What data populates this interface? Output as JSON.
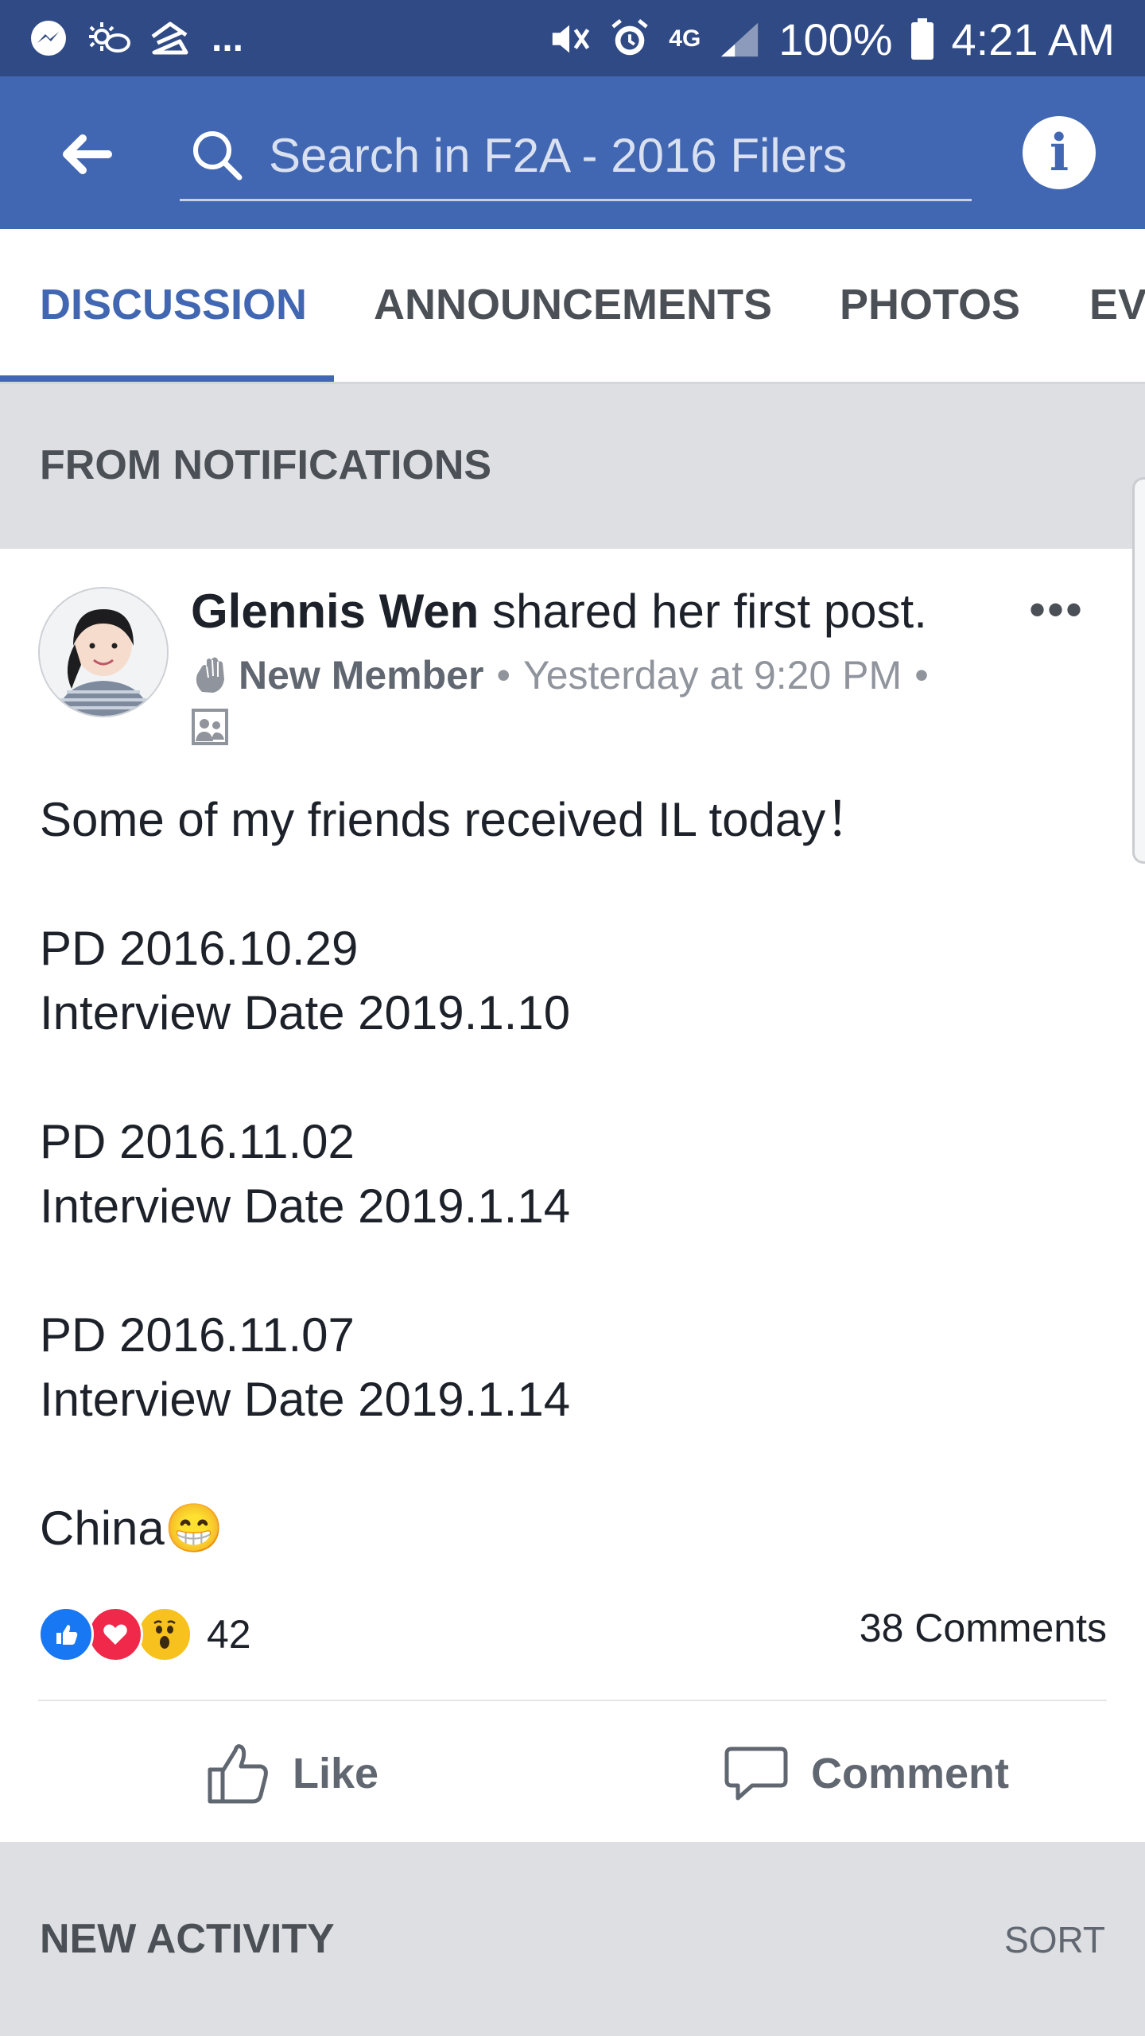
{
  "status_bar": {
    "battery": "100%",
    "time": "4:21 AM",
    "network": "4G",
    "more": "..."
  },
  "app_bar": {
    "search_placeholder": "Search in F2A - 2016 Filers",
    "info_label": "i"
  },
  "tabs": [
    {
      "label": "DISCUSSION",
      "active": true
    },
    {
      "label": "ANNOUNCEMENTS",
      "active": false
    },
    {
      "label": "PHOTOS",
      "active": false
    },
    {
      "label": "EV",
      "active": false
    }
  ],
  "sections": {
    "notifications_title": "FROM NOTIFICATIONS",
    "activity_title": "NEW ACTIVITY",
    "sort_label": "SORT"
  },
  "post": {
    "author": "Glennis Wen",
    "action": "shared her first post.",
    "more": "•••",
    "badge": "New Member",
    "separator": "•",
    "timestamp": "Yesterday at 9:20 PM",
    "lines": [
      "Some of my friends received IL today！",
      "",
      "PD 2016.10.29",
      "Interview Date 2019.1.10",
      "",
      "PD 2016.11.02",
      "Interview Date 2019.1.14",
      "",
      "PD 2016.11.07",
      "Interview Date 2019.1.14",
      "",
      "China😁"
    ],
    "reaction_count": "42",
    "comments_count": "38 Comments",
    "like_label": "Like",
    "comment_label": "Comment"
  },
  "colors": {
    "facebook_blue": "#4267b2",
    "status_bar": "#2f4a85",
    "like_blue": "#1877f2",
    "love_red": "#f0284a",
    "wow_yellow": "#f7c21d"
  }
}
